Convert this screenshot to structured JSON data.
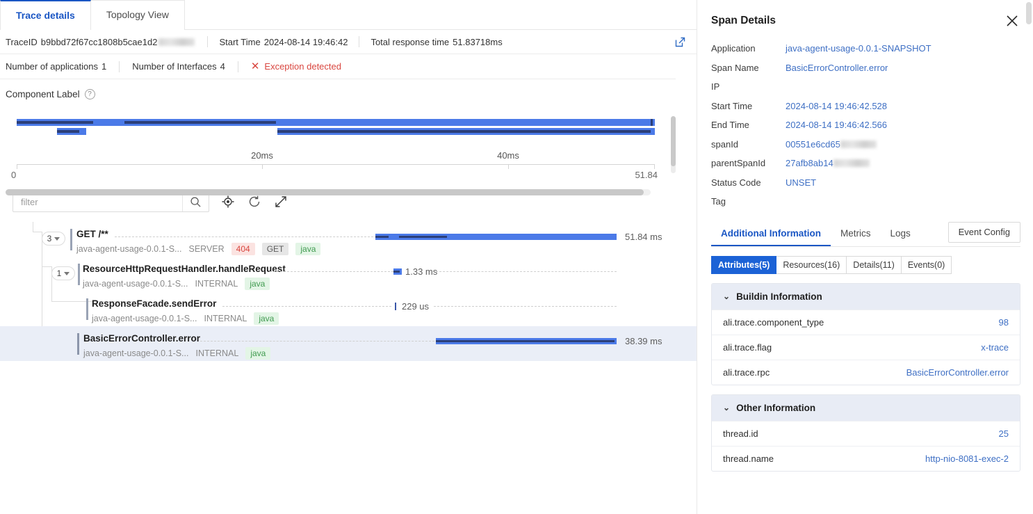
{
  "tabs": [
    {
      "label": "Trace details",
      "active": true
    },
    {
      "label": "Topology View",
      "active": false
    }
  ],
  "trace_header": {
    "traceid_label": "TraceID",
    "traceid_value": "b9bbd72f67cc1808b5cae1d2",
    "traceid_redacted": true,
    "start_time_label": "Start Time",
    "start_time_value": "2024-08-14 19:46:42",
    "total_label": "Total response time",
    "total_value": "51.83718ms",
    "external_link_icon": "external-link-icon"
  },
  "counts": {
    "applications_label": "Number of applications",
    "applications_value": "1",
    "interfaces_label": "Number of Interfaces",
    "interfaces_value": "4",
    "exception_text": "Exception detected",
    "exception_color": "#d9463f"
  },
  "component": {
    "label": "Component Label",
    "help_icon": "question-circle-icon"
  },
  "toolbar": {
    "filter_placeholder": "filter",
    "filter_value": "",
    "search_icon": "search-icon",
    "focus_icon": "crosshair-icon",
    "refresh_icon": "refresh-icon",
    "expand_icon": "expand-icon"
  },
  "chart_data": {
    "type": "bar",
    "title": "Trace waterfall timeline",
    "xlabel": "",
    "ylabel": "",
    "xlim": [
      0,
      51.84
    ],
    "x_tick_labels": [
      "20ms",
      "40ms"
    ],
    "x_tick_values": [
      20,
      40
    ],
    "axis_start_label": "0",
    "axis_end_label": "51.84",
    "grid": false,
    "legend": "none",
    "unit": "ms",
    "bar_colors": {
      "outer": "#4b7ae8",
      "inner": "#2b3f79"
    },
    "overview_rows": [
      {
        "start": 0,
        "end": 51.84,
        "inner_start": 0,
        "inner_end": 21.1
      },
      {
        "start": 5.7,
        "end": 8.0,
        "inner_start": 5.7,
        "inner_end": 7.5
      },
      {
        "start": 13.4,
        "end": 51.8,
        "inner_start": 13.4,
        "inner_end": 51.6
      }
    ],
    "spans": [
      {
        "name": "GET /**",
        "application": "java-agent-usage-0.0.1-S...",
        "kind": "SERVER",
        "status_chip": "404",
        "method_chip": "GET",
        "lang_chip": "java",
        "duration_label": "51.84 ms",
        "duration_ms": 51.84,
        "start_ms": 0,
        "child_count": "3",
        "depth": 0,
        "selected": false
      },
      {
        "name": "ResourceHttpRequestHandler.handleRequest",
        "application": "java-agent-usage-0.0.1-S...",
        "kind": "INTERNAL",
        "status_chip": null,
        "method_chip": null,
        "lang_chip": "java",
        "duration_label": "1.33 ms",
        "duration_ms": 1.33,
        "start_ms": 1.2,
        "child_count": "1",
        "depth": 1,
        "selected": false
      },
      {
        "name": "ResponseFacade.sendError",
        "application": "java-agent-usage-0.0.1-S...",
        "kind": "INTERNAL",
        "status_chip": null,
        "method_chip": null,
        "lang_chip": "java",
        "duration_label": "229 us",
        "duration_ms": 0.229,
        "start_ms": 1.5,
        "child_count": null,
        "depth": 2,
        "selected": false
      },
      {
        "name": "BasicErrorController.error",
        "application": "java-agent-usage-0.0.1-S...",
        "kind": "INTERNAL",
        "status_chip": null,
        "method_chip": null,
        "lang_chip": "java",
        "duration_label": "38.39 ms",
        "duration_ms": 38.39,
        "start_ms": 13.4,
        "child_count": null,
        "depth": 1,
        "selected": true
      }
    ]
  },
  "span_details": {
    "title": "Span Details",
    "close_icon": "close-icon",
    "fields": [
      {
        "key": "Application",
        "value": "java-agent-usage-0.0.1-SNAPSHOT",
        "redacted": false
      },
      {
        "key": "Span Name",
        "value": "BasicErrorController.error",
        "redacted": false
      },
      {
        "key": "IP",
        "value": "",
        "redacted": false
      },
      {
        "key": "Start Time",
        "value": "2024-08-14 19:46:42.528",
        "redacted": false
      },
      {
        "key": "End Time",
        "value": "2024-08-14 19:46:42.566",
        "redacted": false
      },
      {
        "key": "spanId",
        "value": "00551e6cd65",
        "redacted": true
      },
      {
        "key": "parentSpanId",
        "value": "27afb8ab14",
        "redacted": true
      },
      {
        "key": "Status Code",
        "value": "UNSET",
        "redacted": false
      },
      {
        "key": "Tag",
        "value": "",
        "redacted": false
      }
    ],
    "tabs": [
      {
        "label": "Additional Information",
        "active": true
      },
      {
        "label": "Metrics",
        "active": false
      },
      {
        "label": "Logs",
        "active": false
      }
    ],
    "event_config_label": "Event Config",
    "segments": [
      {
        "label": "Attributes(5)",
        "active": true
      },
      {
        "label": "Resources(16)",
        "active": false
      },
      {
        "label": "Details(11)",
        "active": false
      },
      {
        "label": "Events(0)",
        "active": false
      }
    ],
    "sections": [
      {
        "title": "Buildin Information",
        "collapse_icon": "chevron-down-icon",
        "rows": [
          {
            "key": "ali.trace.component_type",
            "value": "98"
          },
          {
            "key": "ali.trace.flag",
            "value": "x-trace"
          },
          {
            "key": "ali.trace.rpc",
            "value": "BasicErrorController.error"
          }
        ]
      },
      {
        "title": "Other Information",
        "collapse_icon": "chevron-down-icon",
        "rows": [
          {
            "key": "thread.id",
            "value": "25"
          },
          {
            "key": "thread.name",
            "value": "http-nio-8081-exec-2"
          }
        ]
      }
    ]
  },
  "colors": {
    "accent": "#1a56c4",
    "bar_outer": "#4b7ae8",
    "bar_inner": "#2b3f79",
    "error": "#d9463f",
    "link": "#3e6fc4",
    "selected_row": "#eaeef7"
  }
}
